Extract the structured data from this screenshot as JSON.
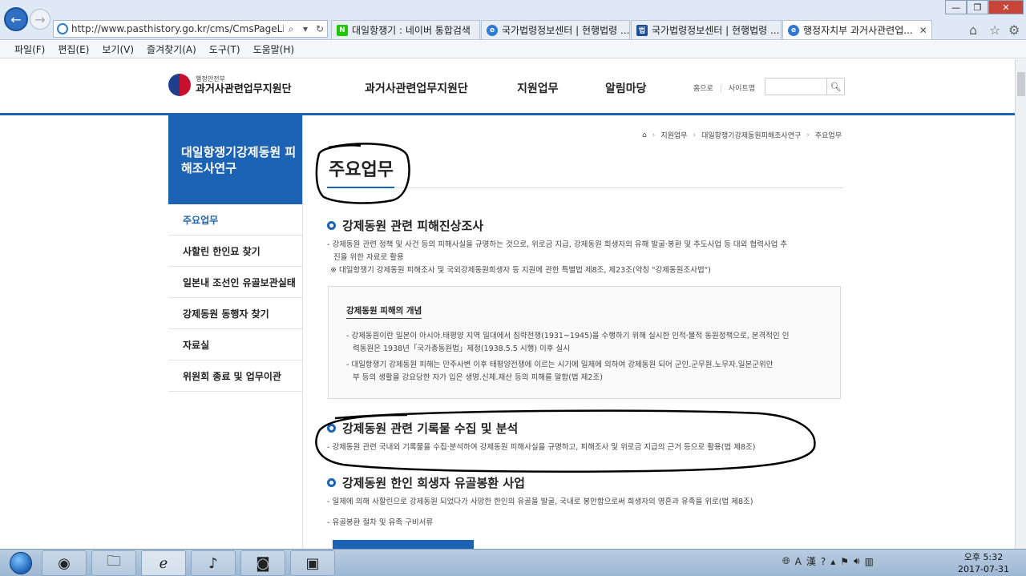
{
  "browser": {
    "url": "http://www.pasthistory.go.kr/cms/CmsPageLink.do?li",
    "tabs": [
      {
        "label": "대일항쟁기 : 네이버 통합검색",
        "fav": "N",
        "fav_color": "#1ec800"
      },
      {
        "label": "국가법령정보센터 | 현행법령 ...",
        "fav": "e",
        "fav_color": "#2d7bd4"
      },
      {
        "label": "국가법령정보센터 | 현행법령 ...",
        "fav": "법",
        "fav_color": "#1d4f98"
      },
      {
        "label": "행정자치부 과거사관련업...",
        "fav": "e",
        "fav_color": "#2d7bd4"
      }
    ],
    "tab_close": "✕",
    "menu": [
      "파일(F)",
      "편집(E)",
      "보기(V)",
      "즐겨찾기(A)",
      "도구(T)",
      "도움말(H)"
    ]
  },
  "site": {
    "logo_small": "행정안전부",
    "logo_big": "과거사관련업무지원단",
    "gnb": [
      "과거사관련업무지원단",
      "지원업무",
      "알림마당"
    ],
    "util": [
      "홈으로",
      "사이트맵"
    ]
  },
  "lnb": {
    "title": "대일항쟁기강제동원 피해조사연구",
    "items": [
      "주요업무",
      "사할린 한인묘 찾기",
      "일본내 조선인 유골보관실태",
      "강제동원 동행자 찾기",
      "자료실",
      "위원회 종료 및 업무이관"
    ]
  },
  "content": {
    "breadcrumb": [
      "지원업무",
      "대일항쟁기강제동원피해조사연구",
      "주요업무"
    ],
    "page_title": "주요업무",
    "sections": [
      {
        "heading": "강제동원 관련 피해진상조사",
        "lines": [
          "- 강제동원 관련 정책 및 사건 등의 피해사실을 규명하는 것으로, 위로금 지급, 강제동원 희생자의 유해 발굴·봉환 및 추도사업 등 대외 협력사업 추",
          "진을 위한 자료로 활용",
          "※ 대일항쟁기 강제동원 피해조사 및 국외강제동원희생자 등 지원에 관한 특별법 제8조, 제23조(약칭 \"강제동원조사법\")"
        ]
      },
      {
        "heading": "강제동원 관련 기록물 수집 및 분석",
        "lines": [
          "- 강제동원 관련 국내외 기록물을 수집·분석하여 강제동원 피해사실을 규명하고, 피해조사 및 위로금 지급의 근거 등으로 활용(법 제8조)"
        ]
      },
      {
        "heading": "강제동원 한인 희생자 유골봉환 사업",
        "lines": [
          "- 일제에 의해 사할린으로 강제동원 되었다가 사망한 한인의 유골을 발굴, 국내로 봉안함으로써 희생자의 영혼과 유족을 위로(법 제8조)",
          "- 유골봉환 절차 및 유족 구비서류"
        ]
      }
    ],
    "concept_box": {
      "title": "강제동원 피해의 개념",
      "items": [
        "- 강제동원이란 일본이 아시아.태평양 지역 일대에서 침략전쟁(1931~1945)을 수행하기 위해 실시한 인적·물적 동원정책으로, 본격적인 인",
        "력동원은 1938년「국가총동원법」제정(1938.5.5 시행) 이후 실시",
        "- 대일항쟁기 강제동원 피해는 만주사변 이후 태평양전쟁에 이르는 시기에 일제에 의하여 강제동원 되어 군인.군무원.노무자.일본군위안",
        "부 등의 생활을 강요당한 자가 입은 생명.신체.재산 등의 피해를 말함(법 제2조)"
      ]
    }
  },
  "taskbar": {
    "clock_time": "오후 5:32",
    "clock_date": "2017-07-31"
  }
}
